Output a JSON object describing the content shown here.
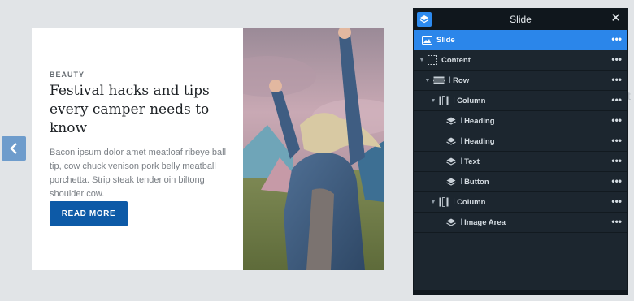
{
  "slide": {
    "category": "BEAUTY",
    "headline": "Festival hacks and tips every camper needs to know",
    "body": "Bacon ipsum dolor amet meatloaf ribeye ball tip, cow chuck venison pork belly meatball porchetta. Strip steak tenderloin biltong shoulder cow.",
    "cta_label": "READ MORE"
  },
  "panel": {
    "title": "Slide",
    "close_icon": "close-icon",
    "nodes": [
      {
        "label": "Slide",
        "icon": "image-icon",
        "active": true
      },
      {
        "label": "Content",
        "icon": "content-box-icon"
      },
      {
        "label": "Row",
        "icon": "row-icon"
      },
      {
        "label": "Column",
        "icon": "column-icon"
      },
      {
        "label": "Heading",
        "icon": "stack-icon"
      },
      {
        "label": "Heading",
        "icon": "stack-icon"
      },
      {
        "label": "Text",
        "icon": "stack-icon"
      },
      {
        "label": "Button",
        "icon": "stack-icon"
      },
      {
        "label": "Column",
        "icon": "column-icon"
      },
      {
        "label": "Image Area",
        "icon": "stack-icon"
      }
    ],
    "menu_icon": "more-dots-icon"
  },
  "colors": {
    "accent": "#2b86ea",
    "cta": "#0d5aa7",
    "panel_bg": "#1c262f"
  }
}
